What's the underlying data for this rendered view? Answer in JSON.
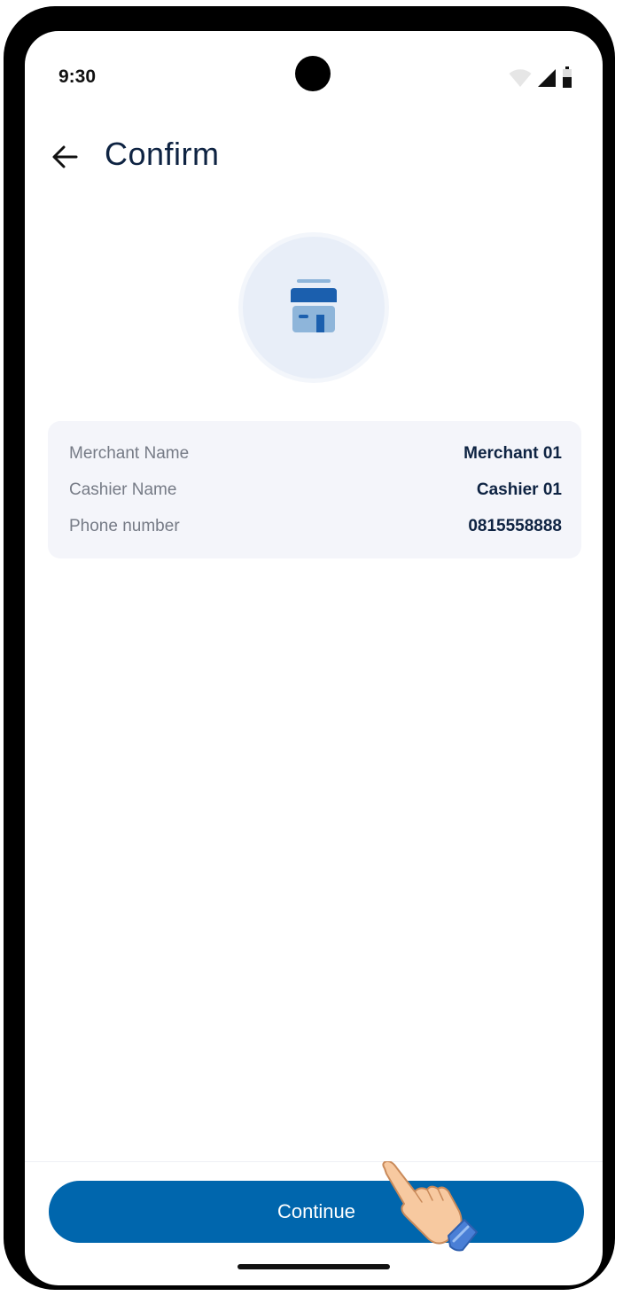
{
  "status_bar": {
    "time": "9:30"
  },
  "header": {
    "title": "Confirm",
    "back_icon": "arrow-left-icon"
  },
  "avatar": {
    "icon": "store-icon"
  },
  "details": {
    "rows": [
      {
        "label": "Merchant Name",
        "value": "Merchant 01"
      },
      {
        "label": "Cashier Name",
        "value": "Cashier 01"
      },
      {
        "label": "Phone number",
        "value": "0815558888"
      }
    ]
  },
  "footer": {
    "continue_label": "Continue"
  },
  "colors": {
    "primary": "#0066ad",
    "title_text": "#0e2342",
    "label_text": "#767b86",
    "card_bg": "#f4f5fa",
    "avatar_bg": "#e8eef8"
  }
}
